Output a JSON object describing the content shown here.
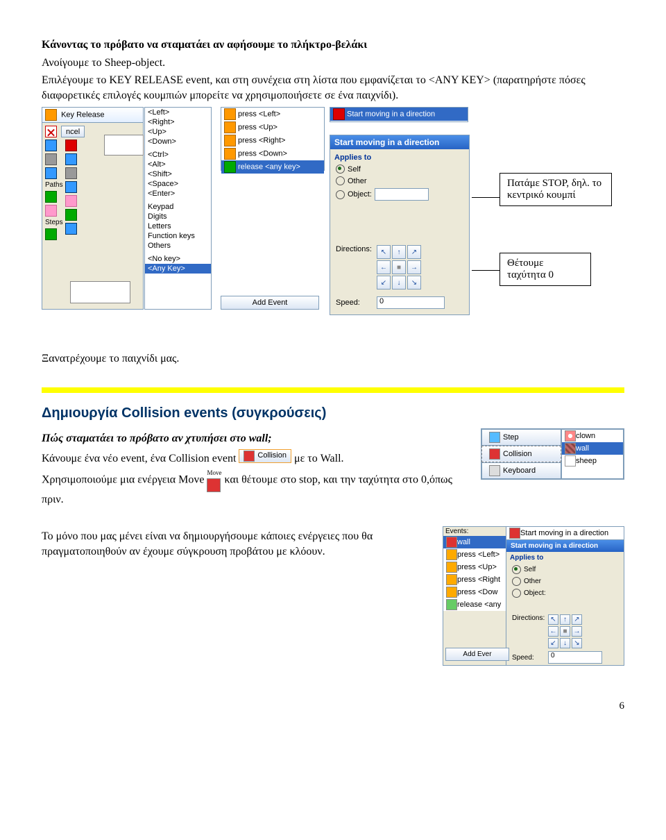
{
  "title_line": "Κάνοντας το πρόβατο να σταματάει αν αφήσουμε το πλήκτρο-βελάκι",
  "p1": "Ανοίγουμε το Sheep-object.",
  "p2": "Επιλέγουμε το KEY RELEASE event, και στη συνέχεια στη λίστα που εμφανίζεται το <ANY KEY> (παρατηρήστε πόσες διαφορετικές επιλογές κουμπιών μπορείτε να χρησιμοποιήσετε σε ένα παιχνίδι).",
  "sidebar": {
    "paths": "Paths",
    "steps": "Steps"
  },
  "btn_cancel": "ncel",
  "klist": [
    "Key Release",
    "<Left>",
    "<Right>",
    "<Up>",
    "<Down>",
    "",
    "<Ctrl>",
    "<Alt>",
    "<Shift>",
    "<Space>",
    "<Enter>",
    "",
    "Keypad",
    "Digits",
    "Letters",
    "Function keys",
    "Others",
    "",
    "<No key>",
    "<Any Key>"
  ],
  "events_list": [
    "press <Left>",
    "press <Up>",
    "press <Right>",
    "press <Down>",
    "release <any key>"
  ],
  "add_event": "Add Event",
  "action_list_top": "Start moving in a direction",
  "dialog": {
    "title": "Start moving in a direction",
    "applies": "Applies to",
    "self": "Self",
    "other": "Other",
    "object": "Object:",
    "directions": "Directions:",
    "speed": "Speed:",
    "speed_val": "0"
  },
  "callout1": "Πατάμε STOP, δηλ. το κεντρικό κουμπί",
  "callout2_a": "Θέτουμε",
  "callout2_b": "ταχύτητα 0",
  "p3": "Ξανατρέχουμε το παιχνίδι μας.",
  "heading2": "Δημιουργία Collision events (συγκρούσεις)",
  "q_line": "Πώς σταματάει το πρόβατο αν χτυπήσει στο wall;",
  "p4a": "Κάνουμε ένα νέο event, ένα Collision event ",
  "p4b": " με το Wall.",
  "collision_btn": "Collision",
  "move_label": "Move",
  "p5a": "Χρησιμοποιούμε μια ενέργεια Move",
  "p5b": " και θέτουμε στο stop, και την ταχύτητα στο 0,όπως πριν.",
  "menu_items": {
    "step": "Step",
    "collision": "Collision",
    "keyboard": "Keyboard",
    "clown": "clown",
    "wall": "wall",
    "sheep": "sheep"
  },
  "p6": "Το μόνο που μας μένει είναι να δημιουργήσουμε κάποιες ενέργειες που θα πραγματοποιηθούν αν έχουμε σύγκρουση προβάτου με κλόουν.",
  "small": {
    "events_h": "Events:",
    "wall": "wall",
    "ev": [
      "press <Left>",
      "press <Up>",
      "press <Right",
      "press <Dow",
      "release <any"
    ],
    "action": "Start moving in a direction",
    "dlg_title": "Start moving in a direction",
    "applies": "Applies to",
    "self": "Self",
    "other": "Other",
    "object": "Object:",
    "directions": "Directions:",
    "speed": "Speed:",
    "speed_val": "0",
    "add": "Add Ever"
  },
  "page": "6"
}
